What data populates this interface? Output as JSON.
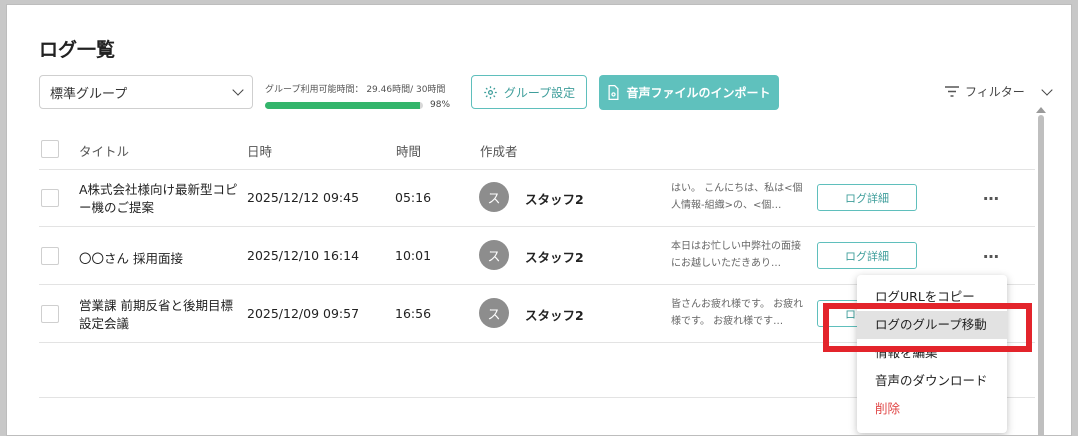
{
  "page": {
    "title": "ログ一覧"
  },
  "toolbar": {
    "group_select_value": "標準グループ",
    "usage_label": "グループ利用可能時間： 29.46時間/ 30時間",
    "usage_percent_text": "98%",
    "usage_fraction": 0.98,
    "group_settings_label": "グループ設定",
    "import_label": "音声ファイルのインポート",
    "filter_label": "フィルター"
  },
  "table": {
    "headers": {
      "title": "タイトル",
      "date": "日時",
      "duration": "時間",
      "author": "作成者"
    },
    "rows": [
      {
        "title": "A株式会社様向け最新型コピー機のご提案",
        "date": "2025/12/12 09:45",
        "duration": "05:16",
        "avatar": "ス",
        "author": "スタッフ2",
        "summary": "はい。 こんにちは、私は<個人情報-組織>の、<個…",
        "detail": "ログ詳細",
        "more": "…"
      },
      {
        "title": "〇〇さん 採用面接",
        "date": "2025/12/10 16:14",
        "duration": "10:01",
        "avatar": "ス",
        "author": "スタッフ2",
        "summary": "本日はお忙しい中弊社の面接にお越しいただきあり…",
        "detail": "ログ詳細",
        "more": "…"
      },
      {
        "title": "営業課 前期反省と後期目標設定会議",
        "date": "2025/12/09 09:57",
        "duration": "16:56",
        "avatar": "ス",
        "author": "スタッフ2",
        "summary": "皆さんお疲れ様です。 お疲れ様です。 お疲れ様です…",
        "detail": "ログ詳細",
        "more": "…"
      }
    ]
  },
  "context_menu": {
    "items": [
      {
        "label": "ログURLをコピー"
      },
      {
        "label": "ログのグループ移動"
      },
      {
        "label": "情報を編集"
      },
      {
        "label": "音声のダウンロード"
      },
      {
        "label": "削除"
      }
    ]
  },
  "colors": {
    "accent": "#5fc1bd",
    "progress": "#33b56b",
    "danger": "#e04646",
    "highlight": "#e3242b"
  }
}
